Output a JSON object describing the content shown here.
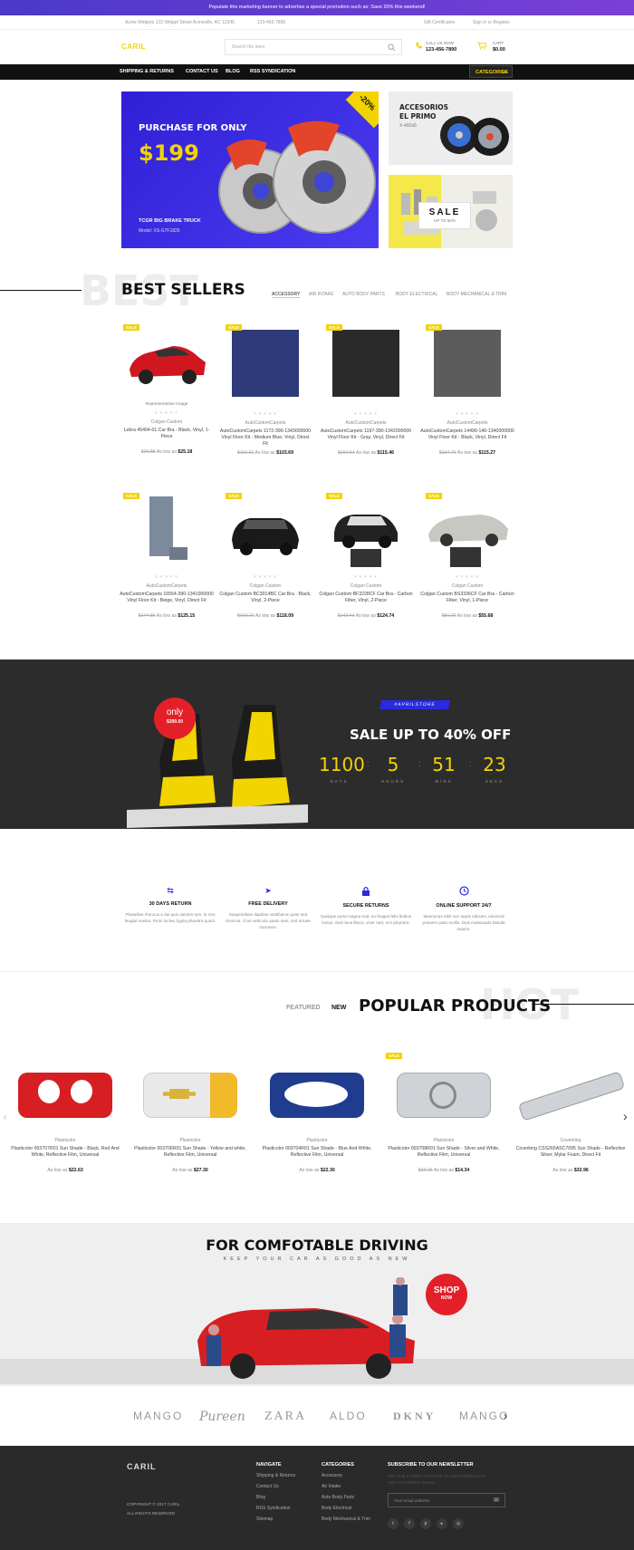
{
  "promo": "Populate this marketing banner to advertise a special promotion such as: Save 20% this weekend!",
  "topbar": {
    "address": "Acme Widgets 123 Widget Street Acmeville, AC 12345",
    "phone": "123-456-7890",
    "gift": "Gift Certificates",
    "signin": "Sign in or Register"
  },
  "header": {
    "logo": "CARIL",
    "search_placeholder": "Search the store",
    "call_label": "CALL US NOW",
    "call_number": "123-456-7890",
    "cart_label": "CART",
    "cart_total": "$0.00"
  },
  "nav": {
    "items": [
      "SHIPPING & RETURNS",
      "CONTACT US",
      "BLOG",
      "RSS SYNDICATION"
    ],
    "categories": "CATEGORIES"
  },
  "hero": {
    "line1": "PURCHASE FOR ONLY",
    "price": "$199",
    "badge": "-20%",
    "product": "TCGR BIG BRAKE TRUCK",
    "model": "Model: XS-G7F1826"
  },
  "side_banners": {
    "title1": "ACCESORIOS",
    "title2": "EL PRIMO",
    "code": "X-492a5",
    "sale": "SALE",
    "sale_sub": "UP TO 50%"
  },
  "bestsellers": {
    "ghost": "BEST",
    "title": "BEST SELLERS",
    "tabs": [
      "ACCESSORY",
      "AIR INTAKE",
      "AUTO BODY PARTS",
      "BODY ELECTRICAL",
      "BODY MECHANICAL & TRIM"
    ],
    "badge": "SALE",
    "rep_image": "Representative Image",
    "as_low_as": "As low as",
    "products": [
      {
        "brand": "Colgan Custom",
        "name": "Lebra 45404-01 Car Bra - Black, Vinyl, 1-Piece",
        "old": "$26.88",
        "new": "$25.18"
      },
      {
        "brand": "AutoCustomCarpets",
        "name": "AutoCustomCarpets 1172-390-1343000000 Vinyl Floor Kit - Medium Blue, Vinyl, Direct Fit",
        "old": "$116.31",
        "new": "$103.69"
      },
      {
        "brand": "AutoCustomCarpets",
        "name": "AutoCustomCarpets 1197-390-1342000000 Vinyl Floor Kit - Gray, Vinyl, Direct Fit",
        "old": "$104.54",
        "new": "$115.46"
      },
      {
        "brand": "AutoCustomCarpets",
        "name": "AutoCustomCarpets 14490-140-1340000000 Vinyl Floor Kit - Black, Vinyl, Direct Fit",
        "old": "$124.70",
        "new": "$115.27"
      },
      {
        "brand": "AutoCustomCarpets",
        "name": "AutoCustomCarpets 16554-390-1341000000 Vinyl Floor Kit - Beige, Vinyl, Direct Fit",
        "old": "$144.85",
        "new": "$125.15"
      },
      {
        "brand": "Colgan Custom",
        "name": "Colgan Custom BC3014BC Car Bra - Black, Vinyl, 2-Piece",
        "old": "$163.20",
        "new": "$118.09"
      },
      {
        "brand": "Colgan Custom",
        "name": "Colgan Custom BF3228CF Car Bra - Carbon Fiber, Vinyl, 2-Piece",
        "old": "$142.40",
        "new": "$124.74"
      },
      {
        "brand": "Colgan Custom",
        "name": "Colgan Custom BS3336CF Car Bra - Carbon Fiber, Vinyl, 1-Piece",
        "old": "$81.20",
        "new": "$55.68"
      }
    ]
  },
  "countdown": {
    "tag": "#APRILSTORE",
    "only": "only",
    "only_price": "$399.00",
    "title": "SALE UP TO 40% OFF",
    "units": [
      {
        "value": "1100",
        "label": "DAYS"
      },
      {
        "value": "5",
        "label": "HOURS"
      },
      {
        "value": "51",
        "label": "MINS"
      },
      {
        "value": "23",
        "label": "SECS"
      }
    ]
  },
  "features": [
    {
      "icon": "return-icon",
      "title": "30 DAYS RETURN",
      "desc": "Phasellus rhoncus a dui quis alemen tum. In non feugiat massa. Proin luctus, ligula pharetra quam."
    },
    {
      "icon": "send-icon",
      "title": "FREE DELIVERY",
      "desc": "Suspendisse dapibus vestibulum justo sed rhoncus. Cras vehicula quam sem, sed ornare rutrumeu."
    },
    {
      "icon": "lock-icon",
      "title": "SECURE RETURNS",
      "desc": "Quisque porta magna erat, eu feugiat felis finibus luctus. Sed risus libero, viver raet, orci pharetra."
    },
    {
      "icon": "clock-icon",
      "title": "ONLINE SUPPORT 24/7",
      "desc": "Maecenas nibh nec turpis ultricies, euismod posuere justo mollis. Duis malesuada blandit mauris."
    }
  ],
  "popular": {
    "tab_featured": "FEATURED",
    "tab_new": "NEW",
    "title": "POPULAR PRODUCTS",
    "ghost": "HOT",
    "badge": "SALE",
    "as_low_as": "As low as",
    "products": [
      {
        "brand": "Plasticolor",
        "name": "Plasticolor 003707R01 Sun Shade - Black, Red And White, Reflective Film, Universal",
        "price": "$22.63"
      },
      {
        "brand": "Plasticolor",
        "name": "Plasticolor 003706R01 Sun Shade - Yellow and white, Reflective Film, Universal",
        "price": "$27.30"
      },
      {
        "brand": "Plasticolor",
        "name": "Plasticolor 003704R01 Sun Shade - Blue And White, Reflective Film, Universal",
        "price": "$22.30"
      },
      {
        "brand": "Plasticolor",
        "name": "Plasticolor 003708R01 Sun Shade - Silver and White, Reflective Film, Universal",
        "old": "$22.16",
        "price": "$14.34"
      },
      {
        "brand": "Coverking",
        "name": "Coverking CSS265ASC7095 Sun Shade - Reflective Silver, Mylar Foam, Direct Fit",
        "price": "$32.96"
      }
    ]
  },
  "driving": {
    "title": "FOR COMFOTABLE DRIVING",
    "sub": "KEEP YOUR CAR AS GOOD AS NEW",
    "shop": "SHOP",
    "now": "NOW"
  },
  "brands": [
    "MANGO",
    "Pureen",
    "ZARA",
    "ALDO",
    "DKNY",
    "MANGO"
  ],
  "footer": {
    "logo": "CARIL",
    "copyright": "COPYRIGHT © 2017 CARIL.",
    "rights": "ALL RIGHTS RESERVED",
    "navigate_title": "NAVIGATE",
    "navigate": [
      "Shipping & Returns",
      "Contact Us",
      "Blog",
      "RSS Syndication",
      "Sitemap"
    ],
    "categories_title": "CATEGORIES",
    "categories": [
      "Accessory",
      "Air Intake",
      "Auto Body Parts",
      "Body Electrical",
      "Body Mechanical & Trim"
    ],
    "newsletter_title": "SUBSCRIBE TO OUR NEWSLETTER",
    "newsletter_sub": "GET THE LATEST UPDATES ON NEW PRODUCTS AND UPCOMING SALES",
    "email_placeholder": "Your email address"
  },
  "colors": {
    "accent": "#f2d400",
    "hero": "#3a2be0",
    "dark": "#2c2c2c",
    "red": "#e3202a"
  }
}
